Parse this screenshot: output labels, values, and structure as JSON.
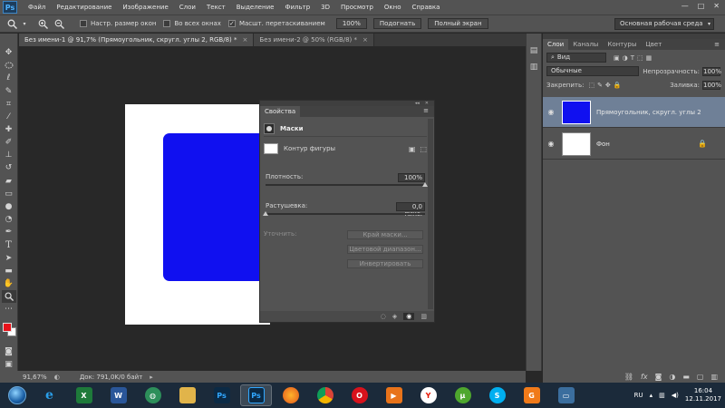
{
  "menubar": {
    "logo": "Ps",
    "items": [
      "Файл",
      "Редактирование",
      "Изображение",
      "Слои",
      "Текст",
      "Выделение",
      "Фильтр",
      "3D",
      "Просмотр",
      "Окно",
      "Справка"
    ],
    "window_controls": [
      "—",
      "□",
      "✕"
    ]
  },
  "optionsbar": {
    "chk_resize": "Настр. размер окон",
    "chk_all_windows": "Во всех окнах",
    "chk_scrubby": "Масшт. перетаскиванием",
    "btn_100": "100%",
    "btn_fit": "Подогнать",
    "btn_fill": "Полный экран",
    "workspace": "Основная рабочая среда"
  },
  "tabs": [
    {
      "title": "Без имени-1 @ 91,7% (Прямоугольник, скругл. углы 2, RGB/8) *",
      "close": "×"
    },
    {
      "title": "Без имени-2 @ 50% (RGB/8) *",
      "close": "×"
    }
  ],
  "properties": {
    "tab": "Свойства",
    "section": "Маски",
    "shape_label": "Контур фигуры",
    "density_label": "Плотность:",
    "density_value": "100%",
    "feather_label": "Растушевка:",
    "feather_value": "0,0 пикс.",
    "refine_label": "Уточнить:",
    "btn_edge": "Край маски...",
    "btn_color": "Цветовой диапазон...",
    "btn_invert": "Инвертировать"
  },
  "layers": {
    "tabs": [
      "Слои",
      "Каналы",
      "Контуры",
      "Цвет"
    ],
    "kind": "Вид",
    "blend_mode": "Обычные",
    "opacity_label": "Непрозрачность:",
    "opacity_value": "100%",
    "lock_label": "Закрепить:",
    "fill_label": "Заливка:",
    "fill_value": "100%",
    "items": [
      {
        "name": "Прямоугольник, скругл. углы 2"
      },
      {
        "name": "Фон"
      }
    ]
  },
  "statusbar": {
    "zoom": "91,67%",
    "doc": "Док: 791,0K/0 байт"
  },
  "taskbar": {
    "lang": "RU",
    "time": "16:04",
    "date": "12.11.2017"
  },
  "colors": {
    "foreground": "#e8121a",
    "background": "#ffffff",
    "shape_fill": "#1010f0"
  }
}
